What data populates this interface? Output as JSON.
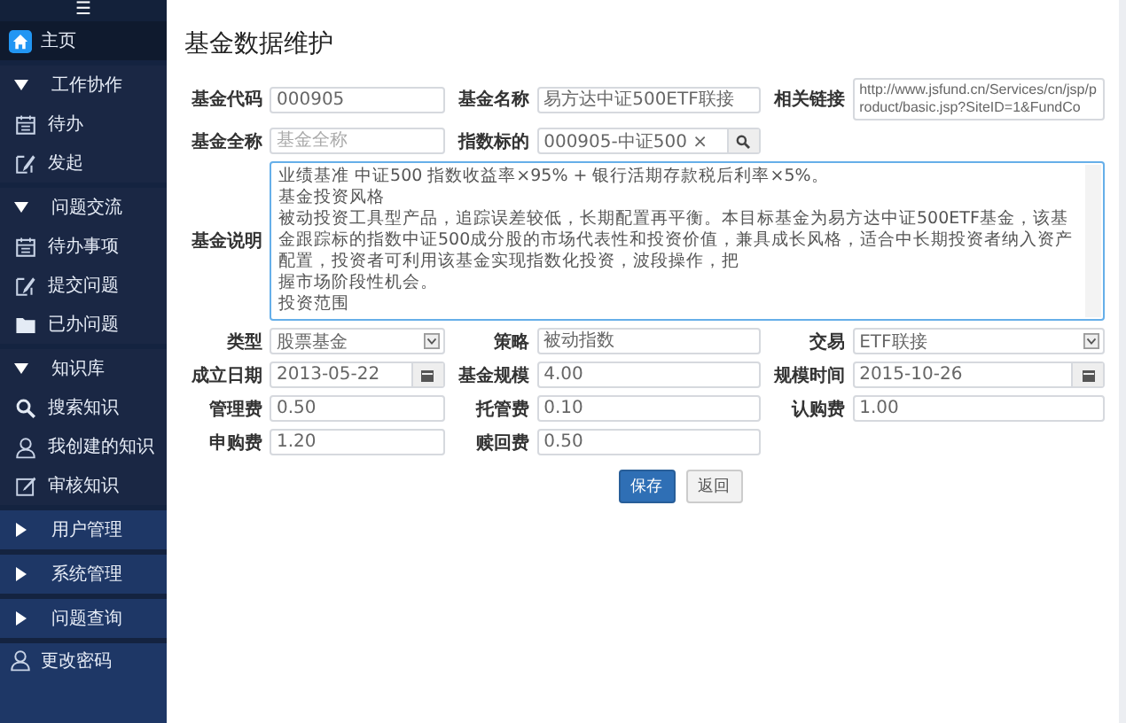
{
  "menu_button": {
    "label": "☰"
  },
  "sidebar": {
    "items": [
      {
        "kind": "home",
        "label": "主页",
        "selected": true
      },
      {
        "kind": "section",
        "label": "工作协作",
        "expanded": true,
        "selected": false,
        "children": [
          {
            "kind": "calendar",
            "label": "待办",
            "selected": false
          },
          {
            "kind": "pen",
            "label": "发起",
            "selected": false
          }
        ]
      },
      {
        "kind": "section",
        "label": "问题交流",
        "expanded": true,
        "selected": false,
        "children": [
          {
            "kind": "calendar",
            "label": "待办事项",
            "selected": false
          },
          {
            "kind": "pen",
            "label": "提交问题",
            "selected": false
          },
          {
            "kind": "folder",
            "label": "已办问题",
            "selected": false
          }
        ]
      },
      {
        "kind": "section",
        "label": "知识库",
        "expanded": true,
        "selected": false,
        "children": [
          {
            "kind": "search",
            "label": "搜索知识",
            "selected": false
          },
          {
            "kind": "user",
            "label": "我创建的知识",
            "selected": false
          },
          {
            "kind": "edit",
            "label": "审核知识",
            "selected": false
          }
        ]
      },
      {
        "kind": "section",
        "label": "用户管理",
        "expanded": false,
        "selected": false
      },
      {
        "kind": "section",
        "label": "系统管理",
        "expanded": false,
        "selected": false
      },
      {
        "kind": "section",
        "label": "问题查询",
        "expanded": false,
        "selected": false
      },
      {
        "kind": "user",
        "label": "更改密码",
        "selected": false
      }
    ]
  },
  "page_title": "基金数据维护",
  "form": {
    "rows": [
      [
        {
          "label": "基金代码",
          "kind": "text",
          "value": "000905"
        },
        {
          "label": "基金名称",
          "kind": "text",
          "value": "易方达中证500ETF联接"
        },
        {
          "label": "相关链接",
          "kind": "url",
          "value": "http://www.jsfund.cn/Services/cn/jsp/product/basic.jsp?SiteID=1&FundCo"
        }
      ],
      [
        {
          "label": "基金全称",
          "kind": "text",
          "placeholder": "基金全称"
        },
        {
          "label": "指数标的",
          "kind": "search",
          "value": "000905-中证500 ×"
        }
      ],
      [
        {
          "label": "基金说明",
          "kind": "textarea",
          "lines": [
            "业绩基准 中证500 指数收益率×95% + 银行活期存款税后利率×5%。",
            "基金投资风格",
            "被动投资工具型产品，追踪误差较低，长期配置再平衡。本目标基金为易方达中证500ETF基金，该基金跟踪标的指数中证500成分股的市场代表性和投资价值，兼具成长风格，适合中长期投资者纳入资产配置，投资者可利用该基金实现指数化投资，波段操作，把",
            "握市场阶段性机会。",
            "投资范围"
          ]
        }
      ],
      [
        {
          "label": "类型",
          "kind": "select",
          "value": "股票基金"
        },
        {
          "label": "策略",
          "kind": "text",
          "value": "被动指数"
        },
        {
          "label": "交易",
          "kind": "select",
          "value": "ETF联接"
        }
      ],
      [
        {
          "label": "成立日期",
          "kind": "date",
          "value": "2013-05-22"
        },
        {
          "label": "基金规模",
          "kind": "text",
          "value": "4.00"
        },
        {
          "label": "规模时间",
          "kind": "date",
          "value": "2015-10-26"
        }
      ],
      [
        {
          "label": "管理费",
          "kind": "text",
          "value": "0.50"
        },
        {
          "label": "托管费",
          "kind": "text",
          "value": "0.10"
        },
        {
          "label": "认购费",
          "kind": "text",
          "value": "1.00"
        }
      ],
      [
        {
          "label": "申购费",
          "kind": "text",
          "value": "1.20"
        },
        {
          "label": "赎回费",
          "kind": "text",
          "value": "0.50"
        }
      ]
    ]
  },
  "buttons": [
    {
      "kind": "primary",
      "label": "保存"
    },
    {
      "kind": "default",
      "label": "返回"
    }
  ]
}
